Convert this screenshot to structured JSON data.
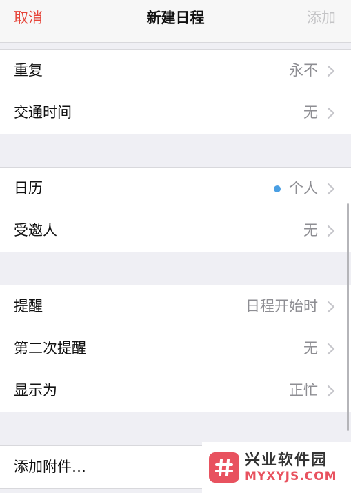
{
  "navbar": {
    "cancel_label": "取消",
    "title": "新建日程",
    "add_label": "添加"
  },
  "groups": [
    {
      "rows": [
        {
          "label": "重复",
          "value": "永不"
        },
        {
          "label": "交通时间",
          "value": "无"
        }
      ]
    },
    {
      "rows": [
        {
          "label": "日历",
          "value": "个人",
          "dot_color": "#4a9fe3"
        },
        {
          "label": "受邀人",
          "value": "无"
        }
      ]
    },
    {
      "rows": [
        {
          "label": "提醒",
          "value": "日程开始时"
        },
        {
          "label": "第二次提醒",
          "value": "无"
        },
        {
          "label": "显示为",
          "value": "正忙"
        }
      ]
    },
    {
      "rows": [
        {
          "label": "添加附件…"
        }
      ]
    }
  ],
  "watermark": {
    "name": "兴业软件园",
    "domain": "MYXYJS.COM"
  },
  "colors": {
    "accent_red": "#e6453a",
    "disabled_gray": "#c4c4c6",
    "secondary_text": "#8e8e93",
    "calendar_dot": "#4a9fe3",
    "background": "#efeff4",
    "watermark_red": "#e8525f"
  },
  "icons": {
    "chevron": "chevron-right-icon",
    "calendar_dot": "calendar-color-dot",
    "watermark_logo": "hash-logo-icon"
  }
}
